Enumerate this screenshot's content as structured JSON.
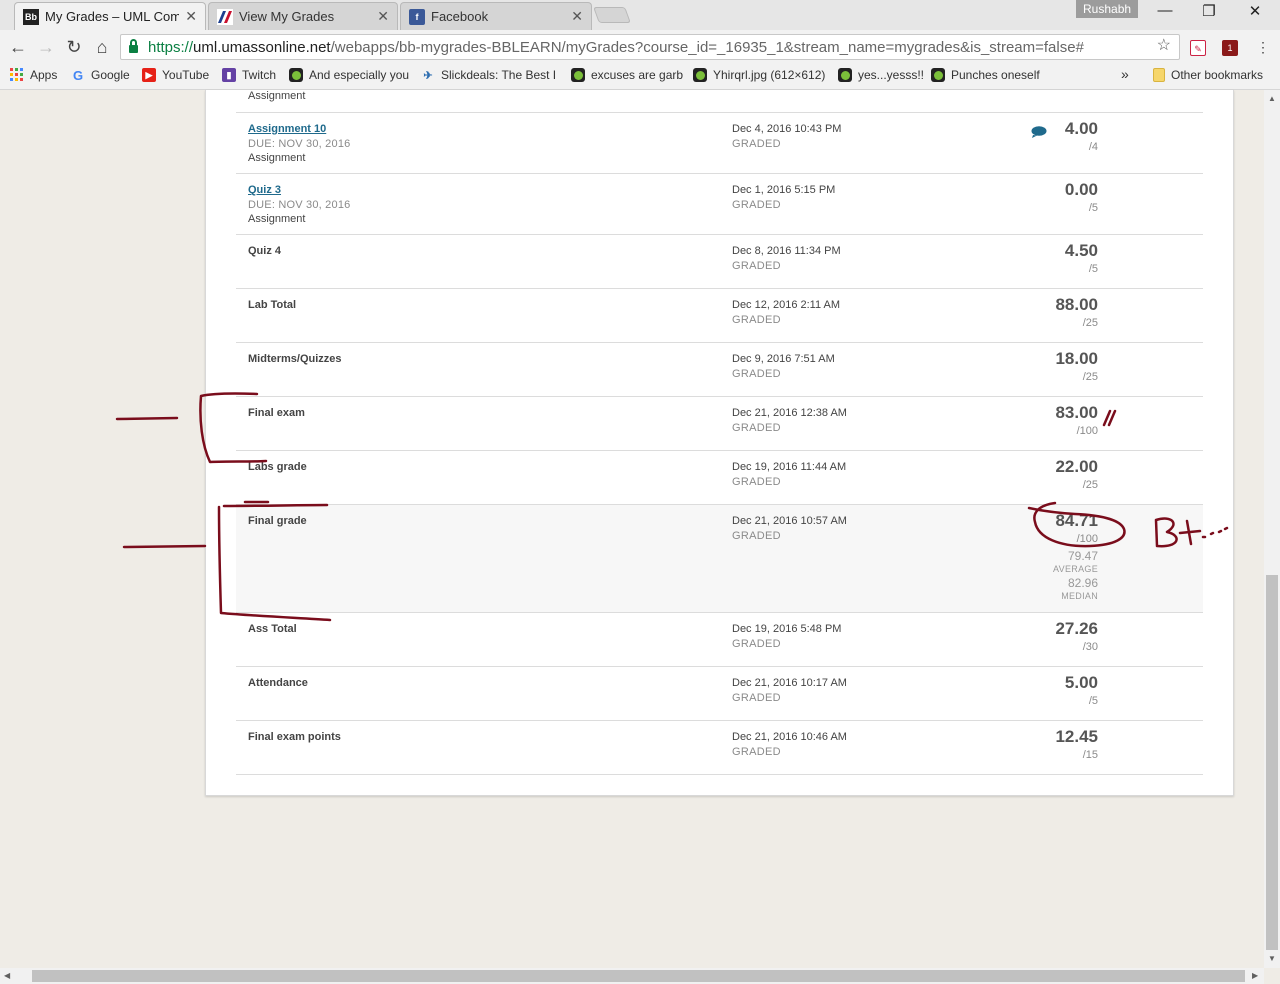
{
  "browser": {
    "tabs": [
      {
        "favicon": "Bb",
        "title": "My Grades – UML Comp",
        "active": true
      },
      {
        "favicon": "uml-logo-icon",
        "title": "View My Grades",
        "active": false
      },
      {
        "favicon": "f",
        "title": "Facebook",
        "active": false
      }
    ],
    "profile_name": "Rushabh",
    "url": {
      "scheme": "https://",
      "host": "uml.umassonline.net",
      "path": "/webapps/bb-mygrades-BBLEARN/myGrades?course_id=_16935_1&stream_name=mygrades&is_stream=false#"
    },
    "bookmarks": [
      {
        "icon": "apps-grid-icon",
        "label": "Apps"
      },
      {
        "icon": "google-icon",
        "label": "Google"
      },
      {
        "icon": "youtube-icon",
        "label": "YouTube"
      },
      {
        "icon": "twitch-icon",
        "label": "Twitch"
      },
      {
        "icon": "green-dot-icon",
        "label": "And especially you"
      },
      {
        "icon": "slickdeals-icon",
        "label": "Slickdeals: The Best D"
      },
      {
        "icon": "green-dot-icon",
        "label": "excuses are garb"
      },
      {
        "icon": "green-dot-icon",
        "label": "Yhirqrl.jpg (612×612)"
      },
      {
        "icon": "green-dot-icon",
        "label": "yes...yesss!!"
      },
      {
        "icon": "green-dot-icon",
        "label": "Punches oneself"
      }
    ],
    "bookmarks_overflow": "»",
    "other_bookmarks": "Other bookmarks",
    "ext_badge": "1"
  },
  "grades": {
    "partial_top_label": "Assignment",
    "rows": [
      {
        "title": "Assignment 10",
        "link": true,
        "due": "DUE: NOV 30, 2016",
        "category": "Assignment",
        "date": "Dec 4, 2016 10:43 PM",
        "status": "GRADED",
        "score": "4.00",
        "possible": "/4",
        "comment": true
      },
      {
        "title": "Quiz 3",
        "link": true,
        "due": "DUE: NOV 30, 2016",
        "category": "Assignment",
        "date": "Dec 1, 2016 5:15 PM",
        "status": "GRADED",
        "score": "0.00",
        "possible": "/5"
      },
      {
        "title": "Quiz 4",
        "date": "Dec 8, 2016 11:34 PM",
        "status": "GRADED",
        "score": "4.50",
        "possible": "/5"
      },
      {
        "title": "Lab Total",
        "date": "Dec 12, 2016 2:11 AM",
        "status": "GRADED",
        "score": "88.00",
        "possible": "/25"
      },
      {
        "title": "Midterms/Quizzes",
        "date": "Dec 9, 2016 7:51 AM",
        "status": "GRADED",
        "score": "18.00",
        "possible": "/25"
      },
      {
        "title": "Final exam",
        "date": "Dec 21, 2016 12:38 AM",
        "status": "GRADED",
        "score": "83.00",
        "possible": "/100"
      },
      {
        "title": "Labs grade",
        "date": "Dec 19, 2016 11:44 AM",
        "status": "GRADED",
        "score": "22.00",
        "possible": "/25"
      },
      {
        "title": "Final grade",
        "highlight": true,
        "date": "Dec 21, 2016 10:57 AM",
        "status": "GRADED",
        "score": "84.71",
        "possible": "/100",
        "average": "79.47",
        "average_label": "AVERAGE",
        "median": "82.96",
        "median_label": "MEDIAN"
      },
      {
        "title": "Ass Total",
        "date": "Dec 19, 2016 5:48 PM",
        "status": "GRADED",
        "score": "27.26",
        "possible": "/30"
      },
      {
        "title": "Attendance",
        "date": "Dec 21, 2016 10:17 AM",
        "status": "GRADED",
        "score": "5.00",
        "possible": "/5"
      },
      {
        "title": "Final exam points",
        "date": "Dec 21, 2016 10:46 AM",
        "status": "GRADED",
        "score": "12.45",
        "possible": "/15"
      }
    ]
  },
  "annotation": {
    "color": "#7a0d1c",
    "handwritten_text": "B+..."
  }
}
